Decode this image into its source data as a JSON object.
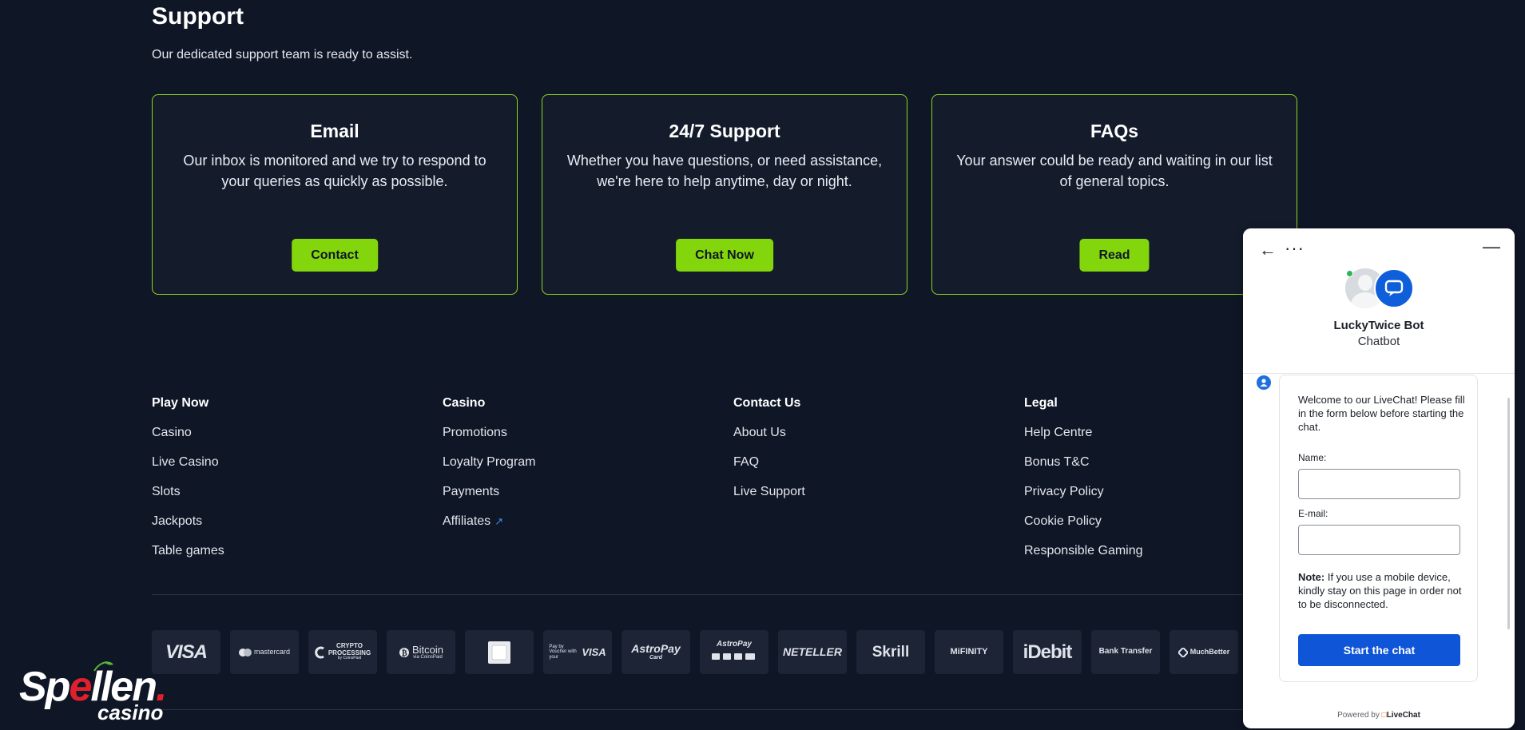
{
  "support": {
    "title": "Support",
    "subtitle": "Our dedicated support team is ready to assist.",
    "cards": [
      {
        "title": "Email",
        "text": "Our inbox is monitored and we try to respond to your queries as quickly as possible.",
        "button": "Contact"
      },
      {
        "title": "24/7 Support",
        "text": "Whether you have questions, or need assistance, we're here to help anytime, day or night.",
        "button": "Chat Now"
      },
      {
        "title": "FAQs",
        "text": "Your answer could be ready and waiting in our list of general topics.",
        "button": "Read"
      }
    ]
  },
  "footer": {
    "columns": [
      {
        "heading": "Play Now",
        "links": [
          "Casino",
          "Live Casino",
          "Slots",
          "Jackpots",
          "Table games"
        ]
      },
      {
        "heading": "Casino",
        "links": [
          "Promotions",
          "Loyalty Program",
          "Payments",
          "Affiliates"
        ]
      },
      {
        "heading": "Contact Us",
        "links": [
          "About Us",
          "FAQ",
          "Live Support"
        ]
      },
      {
        "heading": "Legal",
        "links": [
          "Help Centre",
          "Bonus T&C",
          "Privacy Policy",
          "Cookie Policy",
          "Responsible Gaming"
        ]
      }
    ],
    "external_icon": "↗"
  },
  "payments": {
    "visa": "VISA",
    "mastercard": "mastercard",
    "crypto_line1": "CRYPTO",
    "crypto_line2": "PROCESSING",
    "crypto_by": "by CoinsPaid",
    "bitcoin": "Bitcoin",
    "bitcoin_sub": "via CoinsPaid",
    "paybyvoucher": "Pay by Voucher with your",
    "paybyvoucher_brand": "VISA",
    "astropay_card": "AstroPay",
    "astropay_card_sub": "Card",
    "astropay": "AstroPay",
    "neteller": "NETELLER",
    "skrill": "Skrill",
    "mifinity": "MiFINITY",
    "idebit": "iDebit",
    "bank_transfer": "Bank Transfer",
    "muchbetter": "MuchBetter"
  },
  "logo": {
    "main_before": "Sp",
    "main_e": "e",
    "main_after": "llen",
    "dot": ".",
    "sub": "casino"
  },
  "chat": {
    "back_icon": "←",
    "more_icon": "···",
    "minimize_icon": "—",
    "bot_name": "LuckyTwice Bot",
    "bot_role": "Chatbot",
    "welcome": "Welcome to our LiveChat! Please fill in the form below before starting the chat.",
    "name_label": "Name:",
    "name_value": "",
    "email_label": "E-mail:",
    "email_value": "",
    "note_label": "Note:",
    "note_text": " If you use a mobile device, kindly stay on this page in order not to be disconnected.",
    "start_button": "Start the chat",
    "powered_by": "Powered by",
    "powered_brand": "LiveChat",
    "accent_color": "#0f55d8"
  },
  "colors": {
    "page_bg": "#0f1626",
    "card_border": "#8fd61f",
    "button_green": "#84d60c"
  }
}
